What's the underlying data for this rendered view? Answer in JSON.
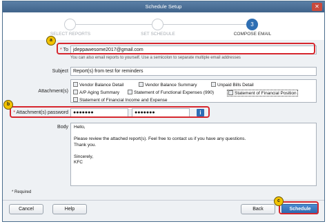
{
  "window": {
    "title": "Schedule Setup",
    "close_glyph": "✕"
  },
  "stepper": {
    "steps": [
      {
        "label": "SELECT REPORTS",
        "number": ""
      },
      {
        "label": "SET SCHEDULE",
        "number": ""
      },
      {
        "label": "COMPOSE EMAIL",
        "number": "3"
      }
    ]
  },
  "form": {
    "to_label": "To",
    "to_value": "jdeppawesome2017@gmail.com",
    "to_hint": "You can also email reports to yourself. Use a semicolon to separate multiple email addresses",
    "subject_label": "Subject",
    "subject_value": "Report(s) from test for reminders",
    "attachments_label": "Attachment(s)",
    "attachments": [
      "Vendor Balance Detail",
      "Vendor Balance Summary",
      "Unpaid Bills Detail",
      "A/P Aging Summary",
      "Statement of Functional Expenses (990)",
      "Statement of Financial Position",
      "Statement of Financial Income and Expense"
    ],
    "password_label": "Attachment(s) password",
    "password_value": "●●●●●●●",
    "password_confirm_value": "●●●●●●●",
    "info_glyph": "i",
    "body_label": "Body",
    "body_lines": [
      "Hello,",
      "",
      "Please review the attached report(s). Feel free to contact us if you have any questions.",
      "Thank you.",
      "",
      "Sincerely,",
      "KFC"
    ],
    "required_note": "* Required",
    "required_star": "*"
  },
  "annotations": {
    "a": "a",
    "b": "b",
    "c": "c"
  },
  "buttons": {
    "cancel": "Cancel",
    "help": "Help",
    "back": "Back",
    "schedule": "Schedule"
  },
  "colors": {
    "highlight": "#d6262d",
    "badge": "#f2c200",
    "primary": "#2f6fb3"
  }
}
